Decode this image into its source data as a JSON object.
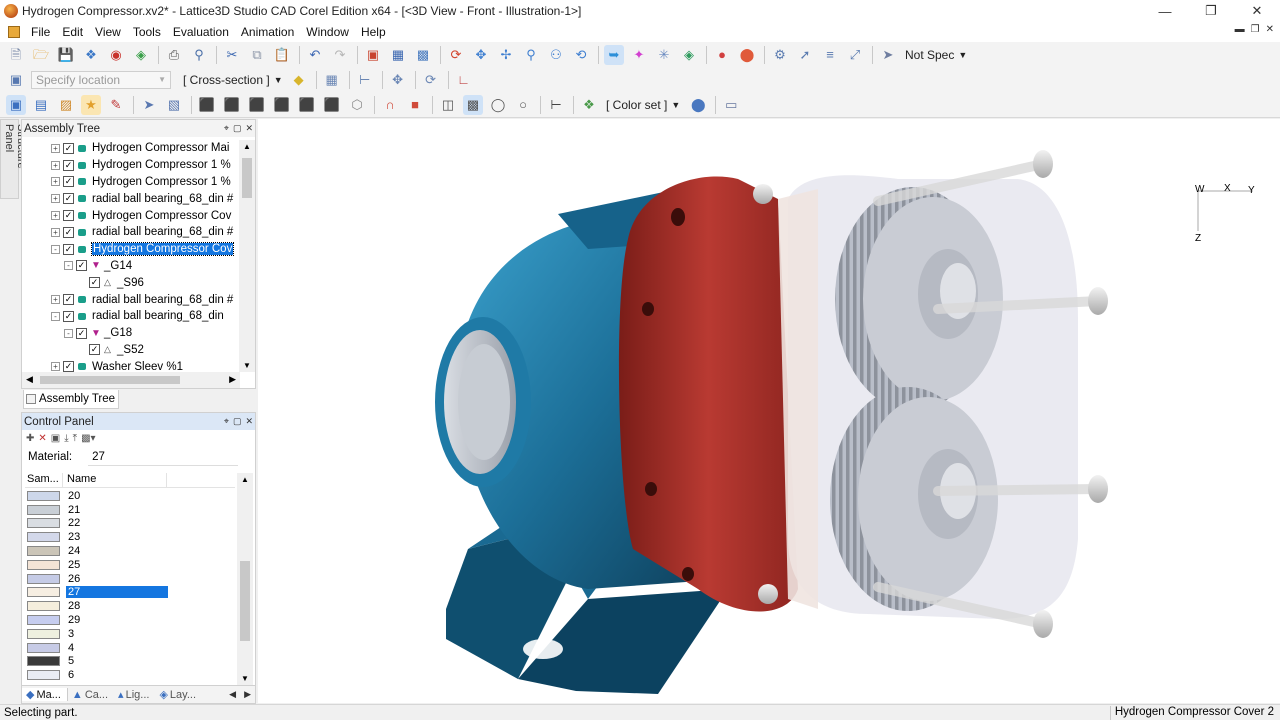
{
  "window": {
    "title": "Hydrogen Compressor.xv2* - Lattice3D Studio CAD Corel Edition x64 - [<3D View - Front - Illustration-1>]"
  },
  "menu": [
    "File",
    "Edit",
    "View",
    "Tools",
    "Evaluation",
    "Animation",
    "Window",
    "Help"
  ],
  "toolbar": {
    "render_mode": "Not Spec",
    "location_placeholder": "Specify location",
    "cross_section": "[ Cross-section ]",
    "color_set": "[ Color set ]"
  },
  "side_tab": {
    "label": "Structure Panel"
  },
  "assembly_tree": {
    "title": "Assembly Tree",
    "tab_label": "Assembly Tree",
    "items": [
      {
        "label": "Hydrogen Compressor Mai",
        "depth": 0,
        "type": "part",
        "expander": "+",
        "selected": false
      },
      {
        "label": "Hydrogen Compressor 1 %",
        "depth": 0,
        "type": "part",
        "expander": "+",
        "selected": false
      },
      {
        "label": "Hydrogen Compressor 1 %",
        "depth": 0,
        "type": "part",
        "expander": "+",
        "selected": false
      },
      {
        "label": "radial ball bearing_68_din #",
        "depth": 0,
        "type": "part",
        "expander": "+",
        "selected": false
      },
      {
        "label": "Hydrogen Compressor Cov",
        "depth": 0,
        "type": "part",
        "expander": "+",
        "selected": false
      },
      {
        "label": "radial ball bearing_68_din #",
        "depth": 0,
        "type": "part",
        "expander": "+",
        "selected": false
      },
      {
        "label": "Hydrogen Compressor Cov",
        "depth": 0,
        "type": "part",
        "expander": "-",
        "selected": true
      },
      {
        "label": "_G14",
        "depth": 1,
        "type": "group",
        "expander": "-",
        "selected": false
      },
      {
        "label": "_S96",
        "depth": 2,
        "type": "shape",
        "expander": "",
        "selected": false
      },
      {
        "label": "radial ball bearing_68_din #",
        "depth": 0,
        "type": "part",
        "expander": "+",
        "selected": false
      },
      {
        "label": "radial ball bearing_68_din",
        "depth": 0,
        "type": "part",
        "expander": "-",
        "selected": false
      },
      {
        "label": "_G18",
        "depth": 1,
        "type": "group",
        "expander": "-",
        "selected": false
      },
      {
        "label": "_S52",
        "depth": 2,
        "type": "shape",
        "expander": "",
        "selected": false
      },
      {
        "label": "Washer Sleev %1",
        "depth": 0,
        "type": "part",
        "expander": "+",
        "selected": false
      }
    ]
  },
  "control_panel": {
    "title": "Control Panel",
    "material_label": "Material:",
    "material_value": "27",
    "col_sample": "Sam...",
    "col_name": "Name",
    "materials": [
      {
        "name": "20",
        "color": "#cdd7ea"
      },
      {
        "name": "21",
        "color": "#c9cfd6"
      },
      {
        "name": "22",
        "color": "#d9dde2"
      },
      {
        "name": "23",
        "color": "#d3d8ea"
      },
      {
        "name": "24",
        "color": "#cbc5b8"
      },
      {
        "name": "25",
        "color": "#f4e4d6"
      },
      {
        "name": "26",
        "color": "#c5cbe6"
      },
      {
        "name": "27",
        "color": "#f6eee2",
        "selected": true
      },
      {
        "name": "28",
        "color": "#f5eedd"
      },
      {
        "name": "29",
        "color": "#c6cdef"
      },
      {
        "name": "3",
        "color": "#eef0df"
      },
      {
        "name": "4",
        "color": "#c7cbe6"
      },
      {
        "name": "5",
        "color": "#3a3a3a"
      },
      {
        "name": "6",
        "color": "#e9ecf3"
      }
    ],
    "tabs": [
      "Ma...",
      "Ca...",
      "Lig...",
      "Lay..."
    ]
  },
  "viewport": {
    "axes": {
      "w": "W",
      "x": "X",
      "y": "Y",
      "z": "Z"
    }
  },
  "status": {
    "left": "Selecting part.",
    "right": "Hydrogen Compressor Cover 2"
  },
  "colors": {
    "housing_blue": "#1c6f98",
    "plate_red": "#b0302a",
    "cover_translucent": "#e2e2ea",
    "selection_blue": "#1476e0"
  }
}
